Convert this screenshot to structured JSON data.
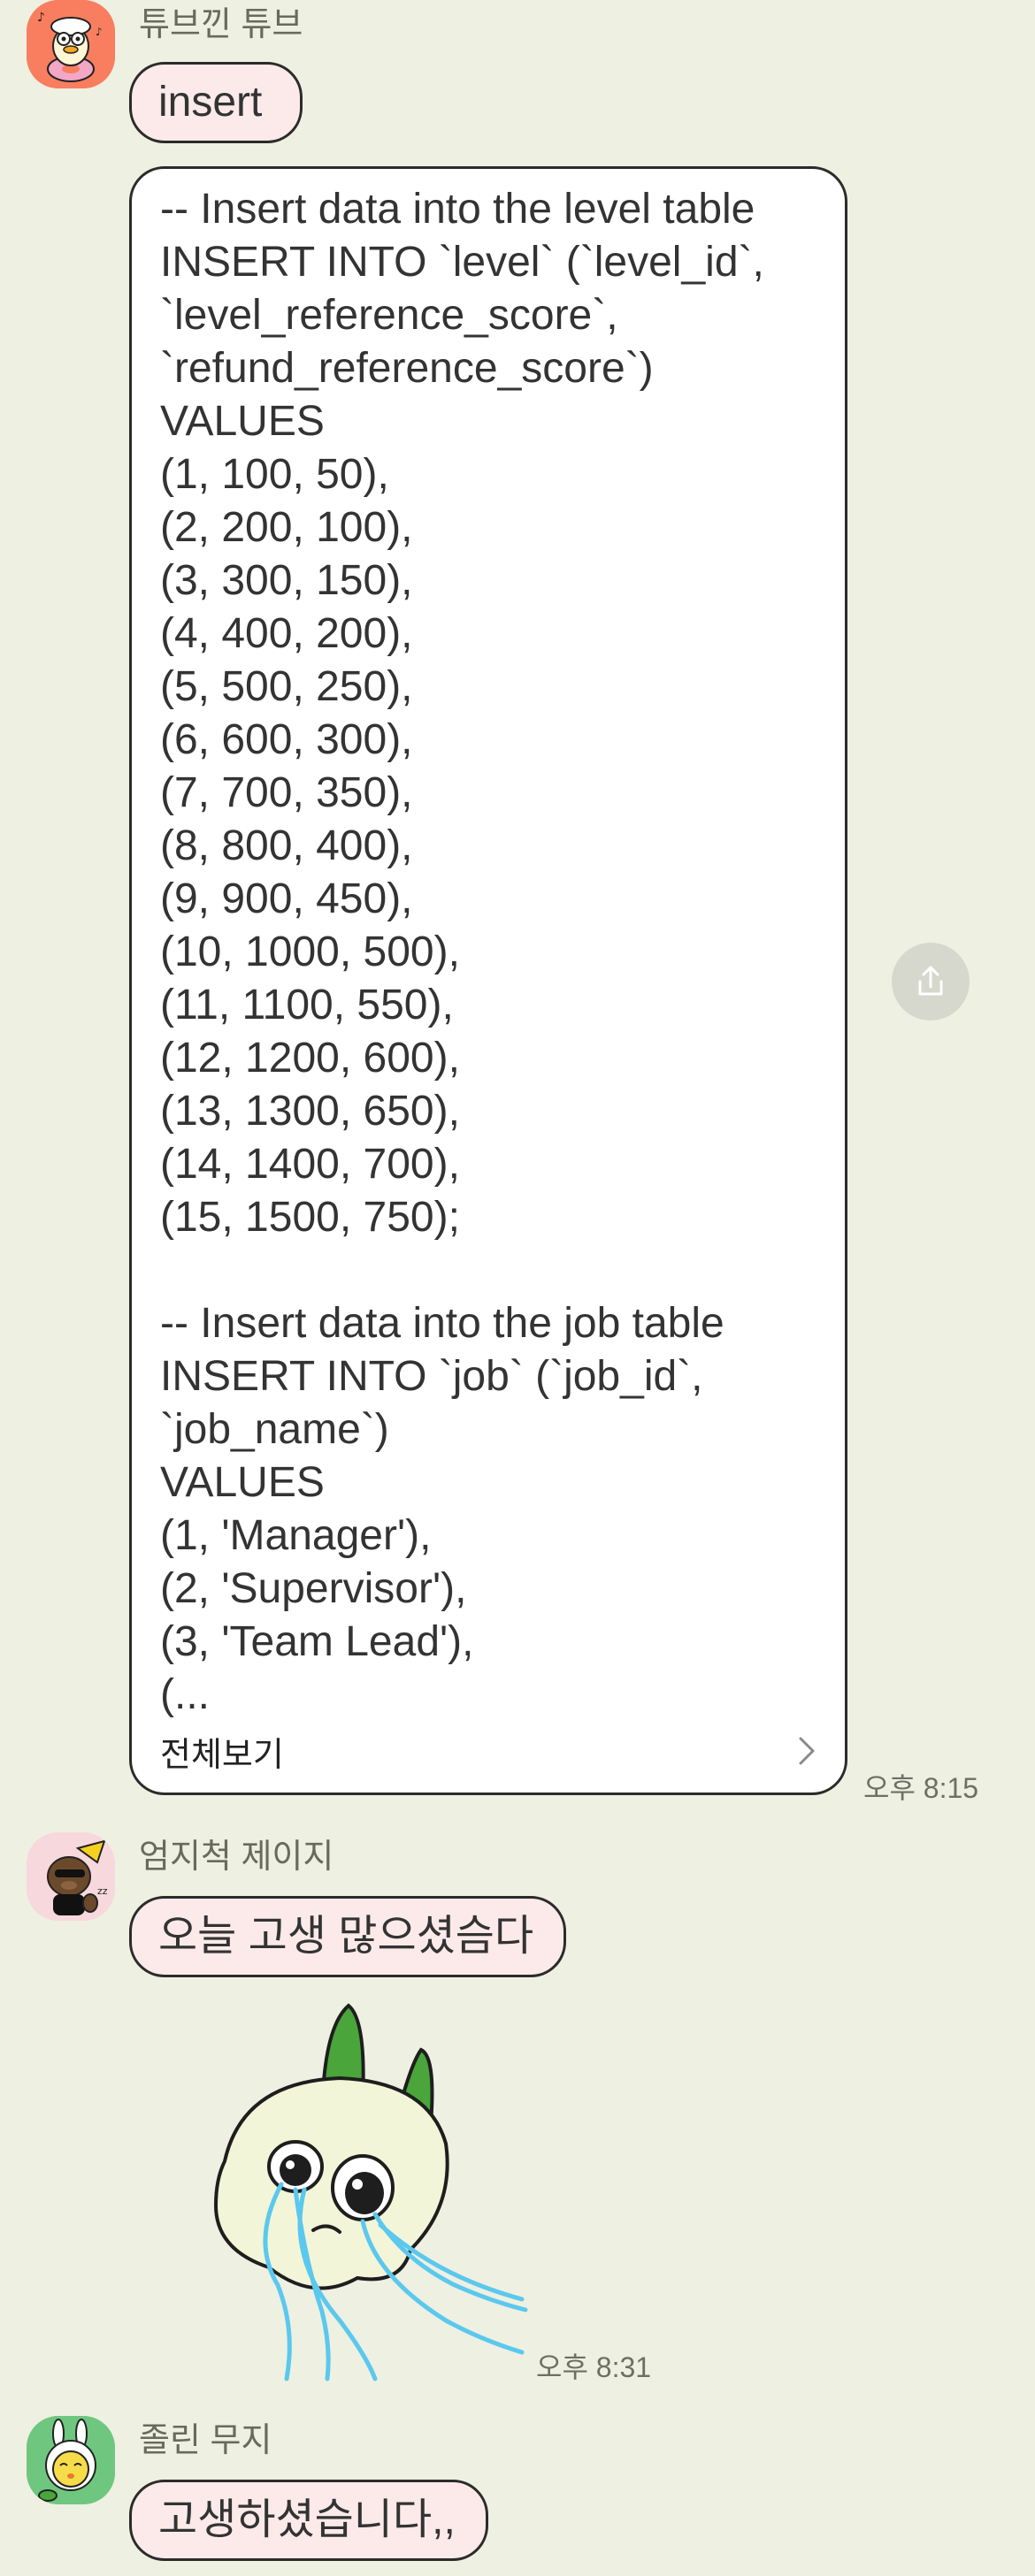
{
  "messages": [
    {
      "sender": "튜브낀 튜브",
      "avatar_icon": "tube-duck-avatar-icon",
      "bubble_text": "insert",
      "long_message": {
        "text": "-- Insert data into the level table\nINSERT INTO `level` (`level_id`,\n`level_reference_score`,\n`refund_reference_score`)\nVALUES\n(1, 100, 50),\n(2, 200, 100),\n(3, 300, 150),\n(4, 400, 200),\n(5, 500, 250),\n(6, 600, 300),\n(7, 700, 350),\n(8, 800, 400),\n(9, 900, 450),\n(10, 1000, 500),\n(11, 1100, 550),\n(12, 1200, 600),\n(13, 1300, 650),\n(14, 1400, 700),\n(15, 1500, 750);\n\n-- Insert data into the job table\nINSERT INTO `job` (`job_id`,\n`job_name`)\nVALUES\n(1, 'Manager'),\n(2, 'Supervisor'),\n(3, 'Team Lead'),\n(...",
        "view_all_label": "전체보기",
        "view_all_icon": "chevron-right-icon"
      },
      "time": "오후 8:15"
    },
    {
      "sender": "엄지척 제이지",
      "avatar_icon": "thumbs-up-jay-g-avatar-icon",
      "bubble_text": "오늘 고생 많으셨슴다",
      "sticker": "crying-muzi-sticker",
      "time": "오후 8:31"
    },
    {
      "sender": "졸린 무지",
      "avatar_icon": "sleepy-muzi-avatar-icon",
      "bubble_text": "고생하셨습니다,,"
    }
  ],
  "share_button_icon": "share-icon",
  "colors": {
    "background": "#eef0e1",
    "bubble_fill": "#fceaea",
    "long_bubble_fill": "#ffffff",
    "bubble_border": "#2b2b2b",
    "share_button": "#d6d8cd",
    "tear_blue": "#5bc8ee"
  }
}
